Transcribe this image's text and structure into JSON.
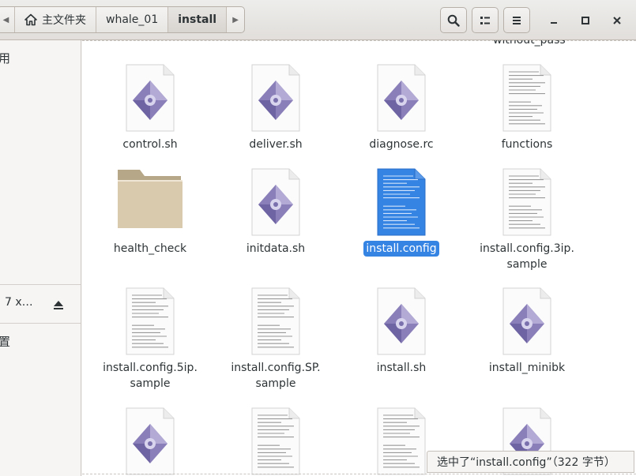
{
  "breadcrumbs": {
    "home_label": "主文件夹",
    "folder1": "whale_01",
    "folder2": "install"
  },
  "header": {
    "search_icon": "search-icon",
    "view_icon": "view-toggle-icon",
    "menu_icon": "menu-icon"
  },
  "sidebar": {
    "item_top": "用",
    "device_label": "7 x…",
    "item_bottom": "置"
  },
  "main": {
    "overflow_name": "without_pass",
    "files": [
      {
        "name": "control.sh",
        "type": "script",
        "selected": false
      },
      {
        "name": "deliver.sh",
        "type": "script",
        "selected": false
      },
      {
        "name": "diagnose.rc",
        "type": "script",
        "selected": false
      },
      {
        "name": "functions",
        "type": "text",
        "selected": false
      },
      {
        "name": "health_check",
        "type": "folder",
        "selected": false
      },
      {
        "name": "initdata.sh",
        "type": "script",
        "selected": false
      },
      {
        "name": "install.config",
        "type": "text",
        "selected": true
      },
      {
        "name": "install.config.3ip.\nsample",
        "type": "text",
        "selected": false
      },
      {
        "name": "install.config.5ip.\nsample",
        "type": "text",
        "selected": false
      },
      {
        "name": "install.config.SP.\nsample",
        "type": "text",
        "selected": false
      },
      {
        "name": "install.sh",
        "type": "script",
        "selected": false
      },
      {
        "name": "install_minibk",
        "type": "script",
        "selected": false
      },
      {
        "name": "",
        "type": "script",
        "selected": false
      },
      {
        "name": "",
        "type": "text",
        "selected": false
      },
      {
        "name": "",
        "type": "text",
        "selected": false
      },
      {
        "name": "",
        "type": "script",
        "selected": false
      }
    ]
  },
  "status": {
    "text": "选中了“install.config”（322 字节）"
  },
  "colors": {
    "selection": "#3584e4",
    "script_icon": "#8a7fb9",
    "folder": "#d9c9ad"
  }
}
